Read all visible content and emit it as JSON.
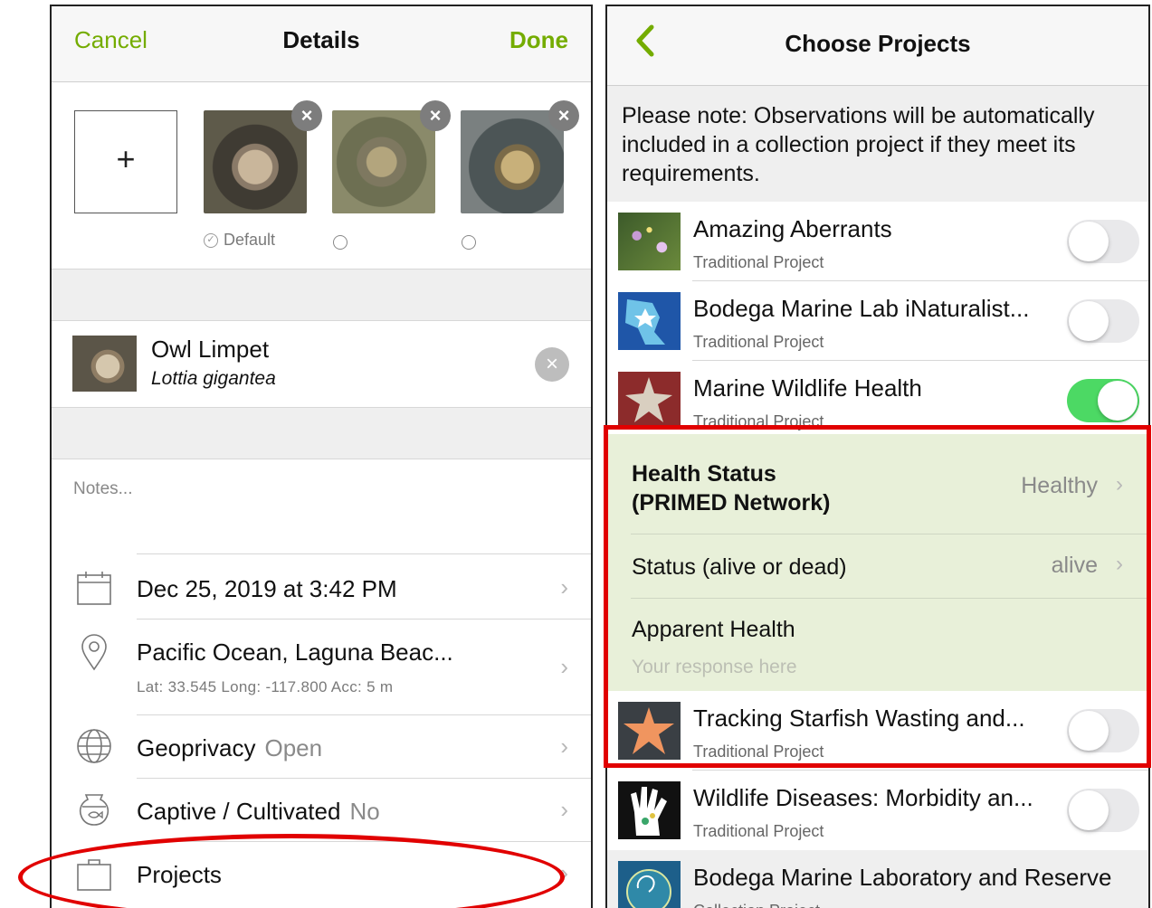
{
  "details": {
    "nav": {
      "cancel": "Cancel",
      "title": "Details",
      "done": "Done"
    },
    "photos": {
      "add": "+",
      "remove": "×",
      "default_label": "Default"
    },
    "taxon": {
      "common_name": "Owl Limpet",
      "scientific_name": "Lottia gigantea",
      "clear": "×"
    },
    "notes_placeholder": "Notes...",
    "rows": {
      "date": {
        "label": "Dec 25, 2019 at 3:42 PM"
      },
      "location": {
        "label": "Pacific Ocean, Laguna Beac...",
        "coords": "Lat: 33.545  Long: -117.800  Acc: 5 m"
      },
      "geoprivacy": {
        "label": "Geoprivacy",
        "value": "Open"
      },
      "captive": {
        "label": "Captive / Cultivated",
        "value": "No"
      },
      "projects": {
        "label": "Projects"
      }
    },
    "chevron": "›"
  },
  "choose_projects": {
    "nav": {
      "title": "Choose Projects"
    },
    "note": "Please note: Observations will be automatically included in a collection project if they meet its requirements.",
    "projects": [
      {
        "name": "Amazing Aberrants",
        "type": "Traditional Project",
        "enabled": false
      },
      {
        "name": "Bodega Marine Lab iNaturalist...",
        "type": "Traditional Project",
        "enabled": false
      },
      {
        "name": "Marine Wildlife Health",
        "type": "Traditional Project",
        "enabled": true
      },
      {
        "name": "Tracking Starfish Wasting and...",
        "type": "Traditional Project",
        "enabled": false
      },
      {
        "name": "Wildlife Diseases: Morbidity an...",
        "type": "Traditional Project",
        "enabled": false
      },
      {
        "name": "Bodega Marine Laboratory and Reserve",
        "type": "Collection Project"
      }
    ],
    "fields": {
      "health_status": {
        "label_line1": "Health Status",
        "label_line2": "(PRIMED Network)",
        "value": "Healthy"
      },
      "status": {
        "label": "Status (alive or dead)",
        "value": "alive"
      },
      "apparent_health": {
        "label": "Apparent Health",
        "placeholder": "Your response here"
      }
    },
    "chevron": "›"
  },
  "colors": {
    "accent_green": "#74ac00",
    "toggle_on": "#4cd964",
    "field_bg": "#e8f0d9",
    "highlight_red": "#e10000"
  }
}
